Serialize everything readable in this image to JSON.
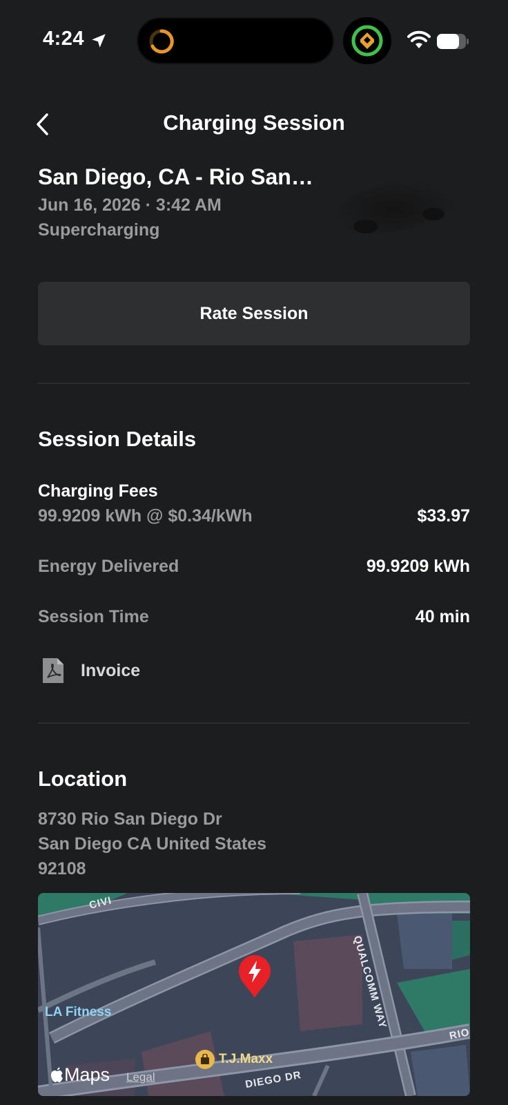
{
  "status_bar": {
    "time": "4:24",
    "icons": [
      "location-arrow-icon",
      "activity-ring-icon",
      "rivian-app-icon",
      "wifi-icon",
      "battery-icon"
    ]
  },
  "header": {
    "title": "Charging Session",
    "back_icon": "chevron-left-icon"
  },
  "session": {
    "site_name": "San Diego, CA - Rio San…",
    "date_time": "Jun 16, 2026 · 3:42 AM",
    "type": "Supercharging",
    "rate_button_label": "Rate Session"
  },
  "details": {
    "title": "Session Details",
    "charging_fees_label": "Charging Fees",
    "charging_fees_detail": "99.9209 kWh @ $0.34/kWh",
    "charging_fees_value": "$33.97",
    "energy_label": "Energy Delivered",
    "energy_value": "99.9209 kWh",
    "time_label": "Session Time",
    "time_value": "40 min",
    "invoice_label": "Invoice",
    "invoice_icon": "pdf-icon"
  },
  "location": {
    "title": "Location",
    "address_line1": "8730 Rio San Diego Dr",
    "address_line2": "San Diego CA United States",
    "address_line3": "92108"
  },
  "map": {
    "poi_1": "LA Fitness",
    "poi_2": "T.J.Maxx",
    "road_1": "CIVI",
    "road_2": "QUALCOMM WAY",
    "road_3": "DIEGO DR",
    "road_4": "RIO",
    "brand": "Maps",
    "legal": "Legal",
    "pin_icon": "supercharger-pin-icon"
  },
  "colors": {
    "background": "#1c1d1f",
    "card": "#2e2f31",
    "secondary_text": "#9a9b9d",
    "pin": "#e82127"
  }
}
